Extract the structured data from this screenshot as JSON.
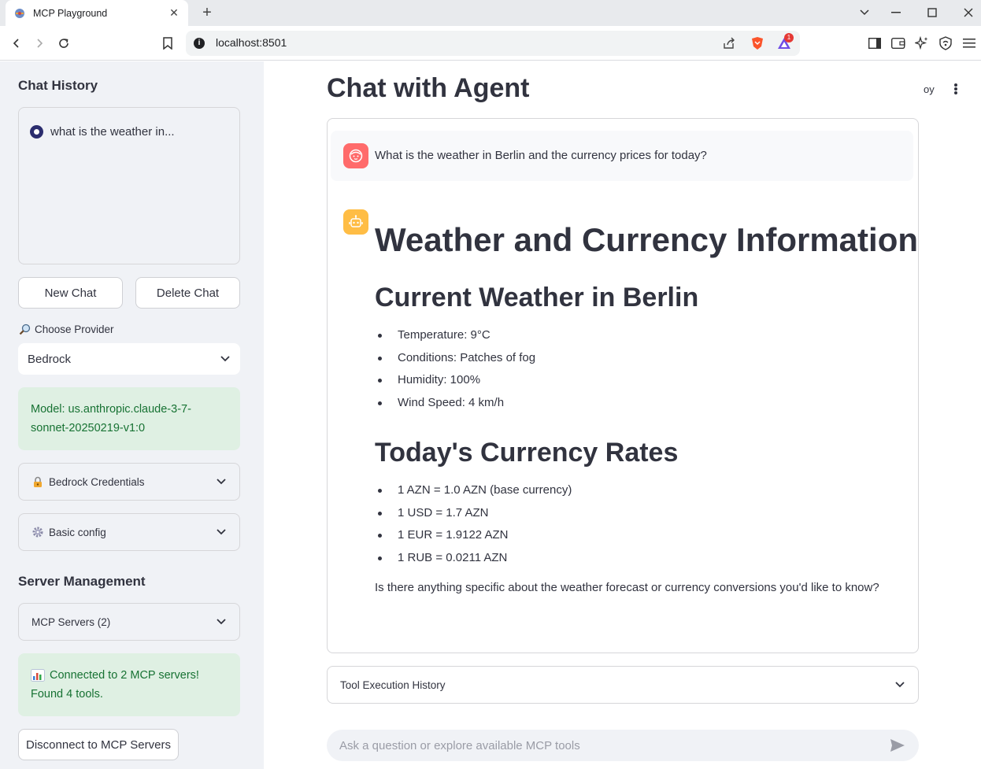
{
  "browser": {
    "tab_title": "MCP Playground",
    "new_tab_label": "+",
    "url": "localhost:8501",
    "brave_rewards_count": "1",
    "icons": [
      "back-icon",
      "forward-icon",
      "reload-icon",
      "bookmark-icon",
      "site-info-icon",
      "share-icon",
      "brave-shields-icon",
      "brave-rewards-icon",
      "sidebar-icon",
      "wallet-icon",
      "leo-ai-icon",
      "vpn-icon",
      "menu-icon",
      "minimize-icon",
      "maximize-icon",
      "close-window-icon",
      "tab-search-icon"
    ]
  },
  "sidebar": {
    "chat_history_title": "Chat History",
    "history_items": [
      {
        "label": "what is the weather in...",
        "selected": true
      }
    ],
    "new_chat_label": "New Chat",
    "delete_chat_label": "Delete Chat",
    "provider_label": "Choose Provider",
    "provider_value": "Bedrock",
    "model_info": "Model: us.anthropic.claude-3-7-sonnet-20250219-v1:0",
    "credentials_label": "Bedrock Credentials",
    "basic_config_label": "Basic config",
    "server_mgmt_title": "Server Management",
    "mcp_servers_label": "MCP Servers (2)",
    "connection_status_line1": "Connected to 2 MCP servers!",
    "connection_status_line2": "Found 4 tools.",
    "disconnect_label": "Disconnect to MCP Servers"
  },
  "main": {
    "title": "Chat with Agent",
    "deploy_label": "oy",
    "user_message": "What is the weather in Berlin and the currency prices for today?",
    "assistant": {
      "heading": "Weather and Currency Information",
      "weather_heading": "Current Weather in Berlin",
      "weather_items": [
        "Temperature: 9°C",
        "Conditions: Patches of fog",
        "Humidity: 100%",
        "Wind Speed: 4 km/h"
      ],
      "currency_heading": "Today's Currency Rates",
      "currency_items": [
        "1 AZN = 1.0 AZN (base currency)",
        "1 USD = 1.7 AZN",
        "1 EUR = 1.9122 AZN",
        "1 RUB = 0.0211 AZN"
      ],
      "closing": "Is there anything specific about the weather forecast or currency conversions you'd like to know?"
    },
    "tool_history_label": "Tool Execution History",
    "chat_input_placeholder": "Ask a question or explore available MCP tools"
  },
  "colors": {
    "sidebar_bg": "#f0f2f6",
    "success_bg": "#dff0e3",
    "success_text": "#177233",
    "user_avatar": "#ff6b6b",
    "assistant_avatar": "#ffbd45",
    "text": "#31333f"
  }
}
